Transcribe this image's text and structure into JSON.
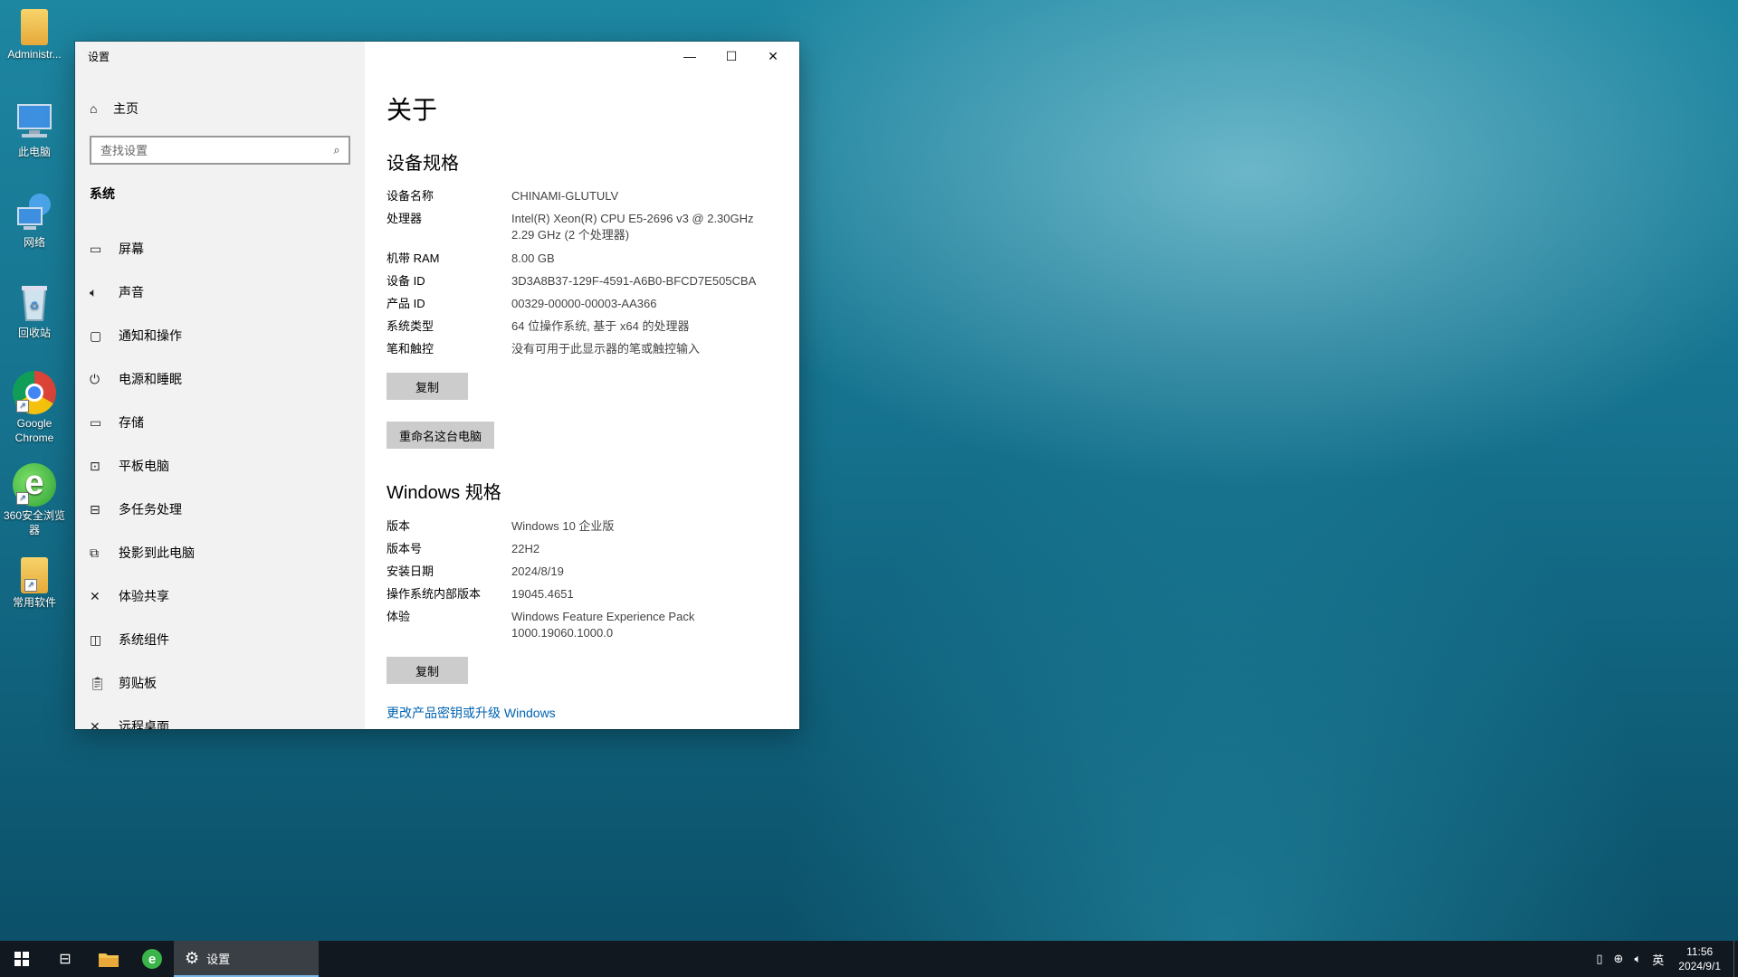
{
  "desktop": {
    "icons": [
      {
        "label": "Administr..."
      },
      {
        "label": "此电脑"
      },
      {
        "label": "网络"
      },
      {
        "label": "回收站"
      },
      {
        "label": "Google Chrome"
      },
      {
        "label": "360安全浏览器"
      },
      {
        "label": "常用软件"
      }
    ]
  },
  "window": {
    "title": "设置",
    "home_label": "主页",
    "search_placeholder": "查找设置",
    "section_label": "系统",
    "nav": [
      {
        "label": "屏幕",
        "icon": "monitor-icon"
      },
      {
        "label": "声音",
        "icon": "speaker-icon"
      },
      {
        "label": "通知和操作",
        "icon": "notification-icon"
      },
      {
        "label": "电源和睡眠",
        "icon": "power-icon"
      },
      {
        "label": "存储",
        "icon": "storage-icon"
      },
      {
        "label": "平板电脑",
        "icon": "tablet-icon"
      },
      {
        "label": "多任务处理",
        "icon": "multitask-icon"
      },
      {
        "label": "投影到此电脑",
        "icon": "project-icon"
      },
      {
        "label": "体验共享",
        "icon": "share-icon"
      },
      {
        "label": "系统组件",
        "icon": "components-icon"
      },
      {
        "label": "剪贴板",
        "icon": "clipboard-icon"
      },
      {
        "label": "远程桌面",
        "icon": "remote-icon"
      }
    ]
  },
  "about": {
    "title": "关于",
    "device_spec_title": "设备规格",
    "device_spec": [
      {
        "key": "设备名称",
        "value": "CHINAMI-GLUTULV"
      },
      {
        "key": "处理器",
        "value": "Intel(R) Xeon(R) CPU E5-2696 v3 @ 2.30GHz",
        "value2": "2.29 GHz  (2 个处理器)"
      },
      {
        "key": "机带 RAM",
        "value": "8.00 GB"
      },
      {
        "key": "设备 ID",
        "value": "3D3A8B37-129F-4591-A6B0-BFCD7E505CBA"
      },
      {
        "key": "产品 ID",
        "value": "00329-00000-00003-AA366"
      },
      {
        "key": "系统类型",
        "value": "64 位操作系统, 基于 x64 的处理器"
      },
      {
        "key": "笔和触控",
        "value": "没有可用于此显示器的笔或触控输入"
      }
    ],
    "copy_label": "复制",
    "rename_label": "重命名这台电脑",
    "windows_spec_title": "Windows 规格",
    "windows_spec": [
      {
        "key": "版本",
        "value": "Windows 10 企业版"
      },
      {
        "key": "版本号",
        "value": "22H2"
      },
      {
        "key": "安装日期",
        "value": "2024/8/19"
      },
      {
        "key": "操作系统内部版本",
        "value": "19045.4651"
      },
      {
        "key": "体验",
        "value": "Windows Feature Experience Pack",
        "value2": "1000.19060.1000.0"
      }
    ],
    "copy2_label": "复制",
    "link_label": "更改产品密钥或升级 Windows"
  },
  "taskbar": {
    "app_label": "设置",
    "ime": "英",
    "time": "11:56",
    "date": "2024/9/1"
  }
}
